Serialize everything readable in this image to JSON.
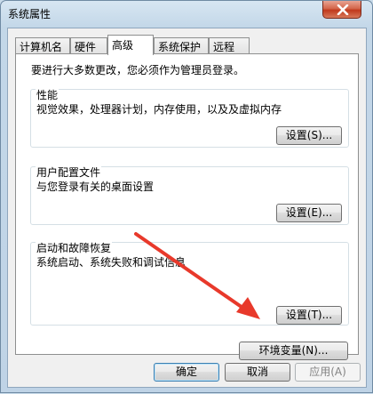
{
  "window": {
    "title": "系统属性"
  },
  "tabs": [
    {
      "label": "计算机名"
    },
    {
      "label": "硬件"
    },
    {
      "label": "高级"
    },
    {
      "label": "系统保护"
    },
    {
      "label": "远程"
    }
  ],
  "intro": "要进行大多数更改，您必须作为管理员登录。",
  "performance": {
    "title": "性能",
    "description": "视觉效果，处理器计划，内存使用，以及及虚拟内存",
    "button": "设置(S)..."
  },
  "user_profiles": {
    "title": "用户配置文件",
    "description": "与您登录有关的桌面设置",
    "button": "设置(E)..."
  },
  "startup_recovery": {
    "title": "启动和故障恢复",
    "description": "系统启动、系统失败和调试信息",
    "button": "设置(T)..."
  },
  "env_button": "环境变量(N)...",
  "footer": {
    "ok": "确定",
    "cancel": "取消",
    "apply": "应用(A)"
  },
  "colors": {
    "annotation_arrow": "#e8392b",
    "close_button": "#c74a2e"
  }
}
